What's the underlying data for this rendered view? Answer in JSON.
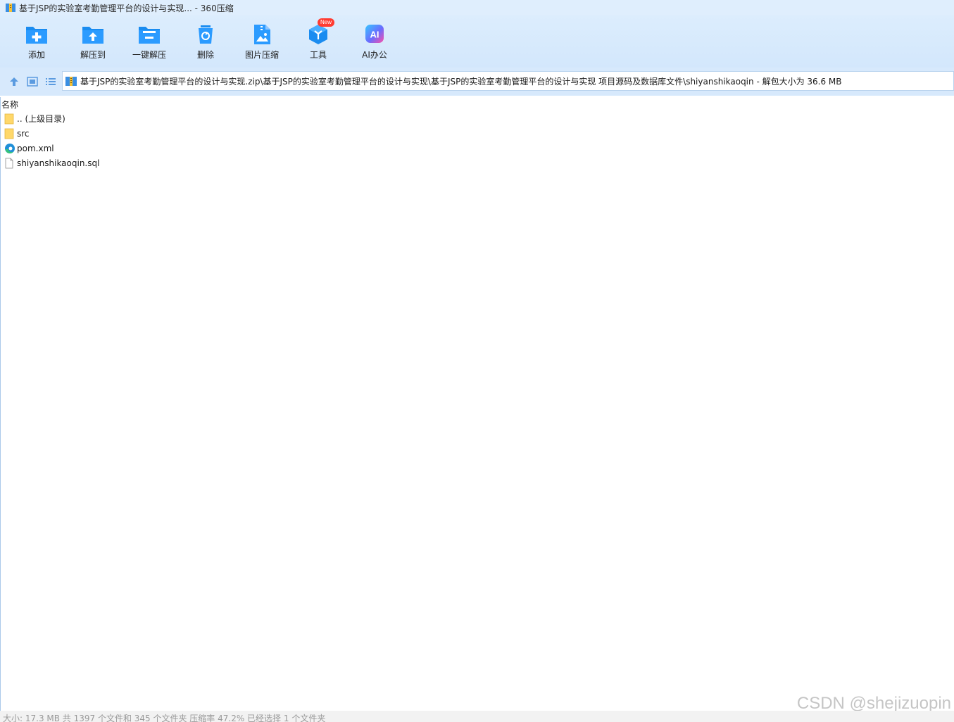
{
  "window": {
    "title": "基于JSP的实验室考勤管理平台的设计与实现... - 360压缩"
  },
  "toolbar": {
    "items": [
      {
        "label": "添加",
        "icon": "add-folder-icon"
      },
      {
        "label": "解压到",
        "icon": "extract-to-icon"
      },
      {
        "label": "一键解压",
        "icon": "one-click-extract-icon"
      },
      {
        "label": "删除",
        "icon": "recycle-bin-icon"
      },
      {
        "label": "图片压缩",
        "icon": "image-compress-icon"
      },
      {
        "label": "工具",
        "icon": "tools-cube-icon",
        "badge": "New"
      },
      {
        "label": "AI办公",
        "icon": "ai-office-icon",
        "icon_text": "AI"
      }
    ]
  },
  "pathbar": {
    "path": "基于JSP的实验室考勤管理平台的设计与实现.zip\\基于JSP的实验室考勤管理平台的设计与实现\\基于JSP的实验室考勤管理平台的设计与实现 项目源码及数据库文件\\shiyanshikaoqin - 解包大小为 36.6 MB"
  },
  "filelist": {
    "column_header": "名称",
    "rows": [
      {
        "name": ".. (上级目录)",
        "icon": "folder-icon"
      },
      {
        "name": "src",
        "icon": "folder-icon"
      },
      {
        "name": "pom.xml",
        "icon": "edge-browser-icon"
      },
      {
        "name": "shiyanshikaoqin.sql",
        "icon": "blank-file-icon"
      }
    ]
  },
  "status": {
    "text": "大小: 17.3 MB 共 1397 个文件和 345 个文件夹 压缩率 47.2% 已经选择 1 个文件夹"
  },
  "watermark": "CSDN @shejizuopin",
  "colors": {
    "accent_blue": "#1a8cf0",
    "toolbar_bg": "#d3e7fc",
    "folder_yellow": "#ffd86a",
    "badge_red": "#ff3b30"
  }
}
